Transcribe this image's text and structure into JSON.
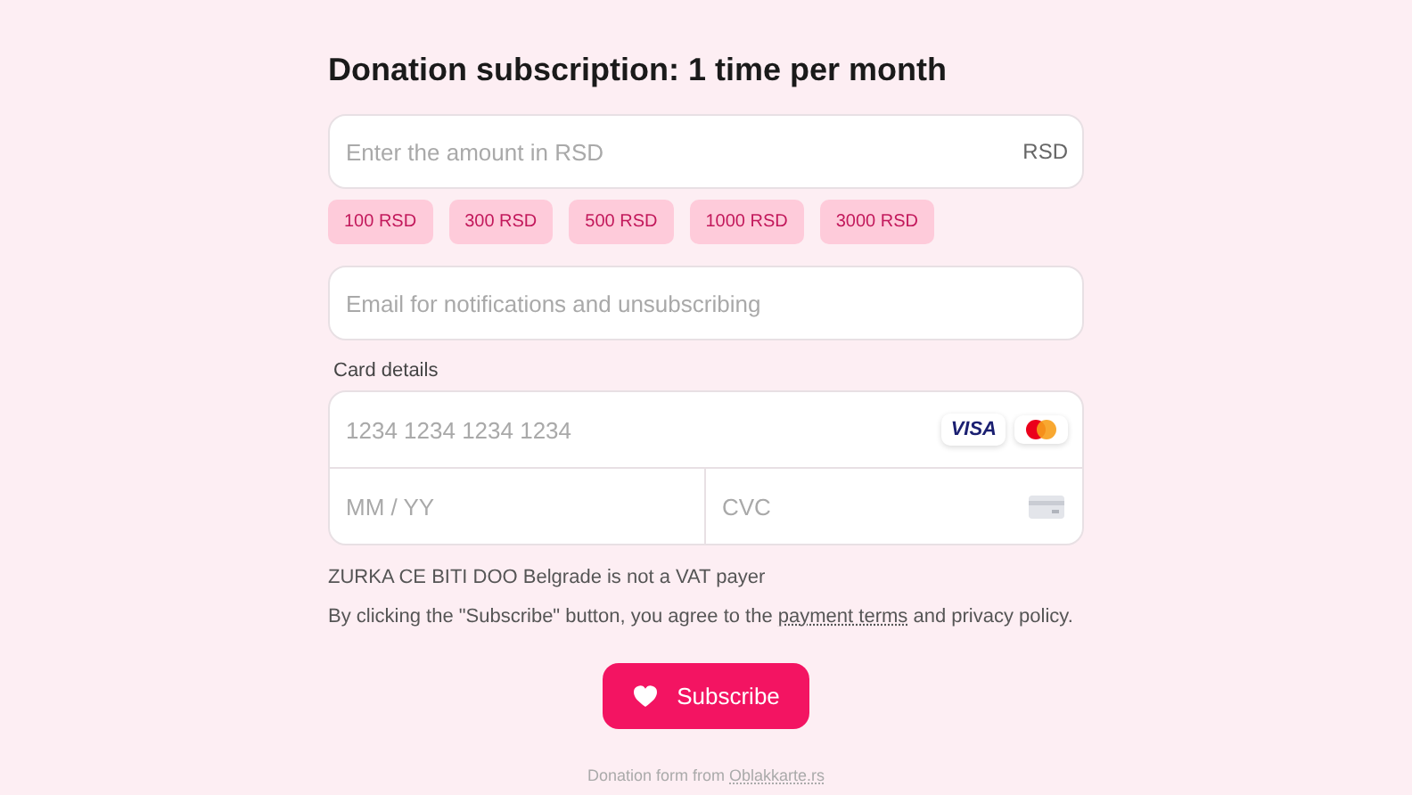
{
  "title": "Donation subscription: 1 time per month",
  "amount": {
    "placeholder": "Enter the amount in RSD",
    "currency": "RSD"
  },
  "presets": [
    "100 RSD",
    "300 RSD",
    "500 RSD",
    "1000 RSD",
    "3000 RSD"
  ],
  "email": {
    "placeholder": "Email for notifications and unsubscribing"
  },
  "card": {
    "label": "Card details",
    "number_placeholder": "1234 1234 1234 1234",
    "visa": "VISA",
    "expiry_placeholder": "MM / YY",
    "cvc_placeholder": "CVC"
  },
  "vat_note": "ZURKA CE BITI DOO Belgrade is not a VAT payer",
  "consent": {
    "before": "By clicking the \"Subscribe\" button, you agree to the ",
    "link": "payment terms",
    "after": " and privacy policy."
  },
  "subscribe_button": "Subscribe",
  "footer": {
    "text": "Donation form from ",
    "link": "Oblakkarte.rs"
  }
}
